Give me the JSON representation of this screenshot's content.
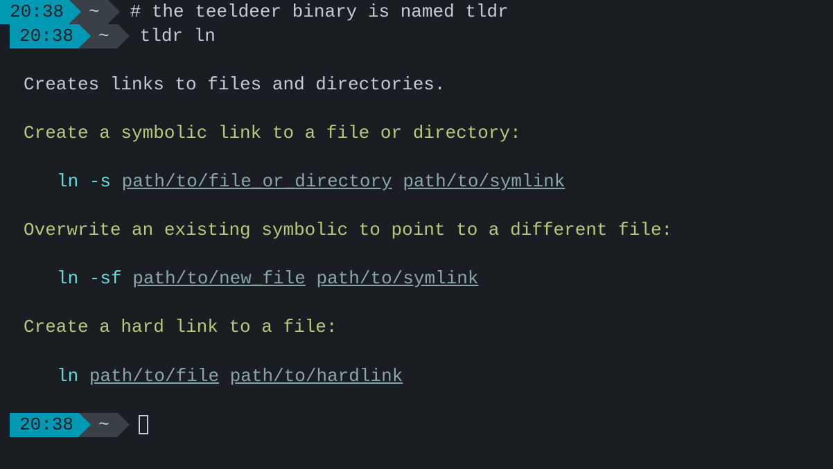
{
  "prompts": [
    {
      "time": "20:38",
      "path": "~",
      "command": "# the teeldeer binary is named tldr",
      "indented": false
    },
    {
      "time": "20:38",
      "path": "~",
      "command": "tldr ln",
      "indented": true
    }
  ],
  "output": {
    "description": "Creates links to files and directories.",
    "examples": [
      {
        "title": "Create a symbolic link to a file or directory:",
        "cmd_prefix": "ln -s ",
        "args": [
          "path/to/file_or_directory",
          "path/to/symlink"
        ]
      },
      {
        "title": "Overwrite an existing symbolic to point to a different file:",
        "cmd_prefix": "ln -sf ",
        "args": [
          "path/to/new_file",
          "path/to/symlink"
        ]
      },
      {
        "title": "Create a hard link to a file:",
        "cmd_prefix": "ln ",
        "args": [
          "path/to/file",
          "path/to/hardlink"
        ]
      }
    ]
  },
  "final_prompt": {
    "time": "20:38",
    "path": "~"
  }
}
